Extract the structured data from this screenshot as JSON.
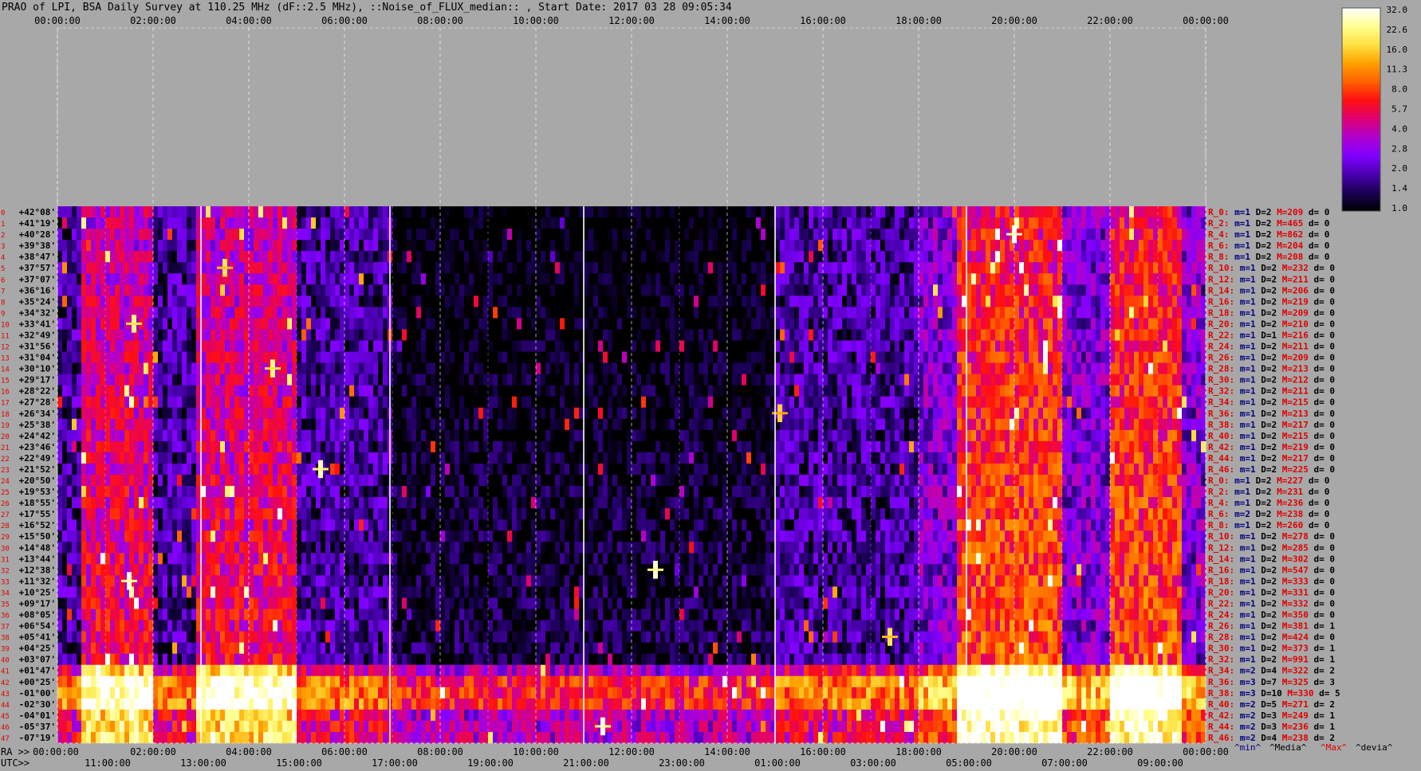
{
  "chart_data": {
    "type": "heatmap",
    "title": "PRAO of LPI, BSA Daily Survey at 110.25 MHz (dF::2.5 MHz), ::Noise_of_FLUX_median:: , Start Date: 2017 03 28 09:05:34",
    "x_axis_top_ticks": [
      "00:00:00",
      "02:00:00",
      "04:00:00",
      "06:00:00",
      "08:00:00",
      "10:00:00",
      "12:00:00",
      "14:00:00",
      "16:00:00",
      "18:00:00",
      "20:00:00",
      "22:00:00",
      "00:00:00"
    ],
    "x_axis_bottom_ra_label": "RA >>",
    "x_axis_bottom_ra_ticks": [
      "00:00:00",
      "02:00:00",
      "04:00:00",
      "06:00:00",
      "08:00:00",
      "10:00:00",
      "12:00:00",
      "14:00:00",
      "16:00:00",
      "18:00:00",
      "20:00:00",
      "22:00:00",
      "00:00:00"
    ],
    "x_axis_bottom_utc_label": "UTC>>",
    "x_axis_bottom_utc_ticks": [
      "11:00:00",
      "13:00:00",
      "15:00:00",
      "17:00:00",
      "19:00:00",
      "21:00:00",
      "23:00:00",
      "01:00:00",
      "03:00:00",
      "05:00:00",
      "07:00:00",
      "09:00:00"
    ],
    "declinations": [
      "+42°08'",
      "+41°19'",
      "+40°28'",
      "+39°38'",
      "+38°47'",
      "+37°57'",
      "+37°07'",
      "+36°16'",
      "+35°24'",
      "+34°32'",
      "+33°41'",
      "+32°49'",
      "+31°56'",
      "+31°04'",
      "+30°10'",
      "+29°17'",
      "+28°22'",
      "+27°28'",
      "+26°34'",
      "+25°38'",
      "+24°42'",
      "+23°46'",
      "+22°49'",
      "+21°52'",
      "+20°50'",
      "+19°53'",
      "+18°55'",
      "+17°55'",
      "+16°52'",
      "+15°50'",
      "+14°48'",
      "+13°44'",
      "+12°38'",
      "+11°32'",
      "+10°25'",
      "+09°17'",
      "+08°05'",
      "+06°54'",
      "+05°41'",
      "+04°25'",
      "+03°07'",
      "+01°47'",
      "+00°25'",
      "-01°00'",
      "-02°30'",
      "-04°01'",
      "-05°37'",
      "-07°19'"
    ],
    "row_index_labels": [
      "0",
      "1",
      "2",
      "3",
      "4",
      "5",
      "6",
      "7",
      "8",
      "9",
      "10",
      "11",
      "12",
      "13",
      "14",
      "15",
      "16",
      "17",
      "18",
      "19",
      "20",
      "21",
      "22",
      "23",
      "24",
      "25",
      "26",
      "27",
      "28",
      "29",
      "30",
      "31",
      "32",
      "33",
      "34",
      "35",
      "36",
      "37",
      "38",
      "39",
      "40",
      "41",
      "42",
      "43",
      "44",
      "45",
      "46",
      "47"
    ],
    "right_stats": [
      {
        "r": "R_0:",
        "m": "m=1",
        "D": "D=2",
        "M": "M=209",
        "d": "d= 0"
      },
      {
        "r": "R_2:",
        "m": "m=1",
        "D": "D=2",
        "M": "M=465",
        "d": "d= 0"
      },
      {
        "r": "R_4:",
        "m": "m=1",
        "D": "D=2",
        "M": "M=862",
        "d": "d= 0"
      },
      {
        "r": "R_6:",
        "m": "m=1",
        "D": "D=2",
        "M": "M=204",
        "d": "d= 0"
      },
      {
        "r": "R_8:",
        "m": "m=1",
        "D": "D=2",
        "M": "M=208",
        "d": "d= 0"
      },
      {
        "r": "R_10:",
        "m": "m=1",
        "D": "D=2",
        "M": "M=232",
        "d": "d= 0"
      },
      {
        "r": "R_12:",
        "m": "m=1",
        "D": "D=2",
        "M": "M=211",
        "d": "d= 0"
      },
      {
        "r": "R_14:",
        "m": "m=1",
        "D": "D=2",
        "M": "M=206",
        "d": "d= 0"
      },
      {
        "r": "R_16:",
        "m": "m=1",
        "D": "D=2",
        "M": "M=219",
        "d": "d= 0"
      },
      {
        "r": "R_18:",
        "m": "m=1",
        "D": "D=2",
        "M": "M=209",
        "d": "d= 0"
      },
      {
        "r": "R_20:",
        "m": "m=1",
        "D": "D=2",
        "M": "M=210",
        "d": "d= 0"
      },
      {
        "r": "R_22:",
        "m": "m=1",
        "D": "D=1",
        "M": "M=216",
        "d": "d= 0"
      },
      {
        "r": "R_24:",
        "m": "m=1",
        "D": "D=2",
        "M": "M=211",
        "d": "d= 0"
      },
      {
        "r": "R_26:",
        "m": "m=1",
        "D": "D=2",
        "M": "M=209",
        "d": "d= 0"
      },
      {
        "r": "R_28:",
        "m": "m=1",
        "D": "D=2",
        "M": "M=213",
        "d": "d= 0"
      },
      {
        "r": "R_30:",
        "m": "m=1",
        "D": "D=2",
        "M": "M=212",
        "d": "d= 0"
      },
      {
        "r": "R_32:",
        "m": "m=1",
        "D": "D=2",
        "M": "M=211",
        "d": "d= 0"
      },
      {
        "r": "R_34:",
        "m": "m=1",
        "D": "D=2",
        "M": "M=215",
        "d": "d= 0"
      },
      {
        "r": "R_36:",
        "m": "m=1",
        "D": "D=2",
        "M": "M=213",
        "d": "d= 0"
      },
      {
        "r": "R_38:",
        "m": "m=1",
        "D": "D=2",
        "M": "M=217",
        "d": "d= 0"
      },
      {
        "r": "R_40:",
        "m": "m=1",
        "D": "D=2",
        "M": "M=215",
        "d": "d= 0"
      },
      {
        "r": "R_42:",
        "m": "m=1",
        "D": "D=2",
        "M": "M=219",
        "d": "d= 0"
      },
      {
        "r": "R_44:",
        "m": "m=1",
        "D": "D=2",
        "M": "M=217",
        "d": "d= 0"
      },
      {
        "r": "R_46:",
        "m": "m=1",
        "D": "D=2",
        "M": "M=225",
        "d": "d= 0"
      },
      {
        "r": "R_0:",
        "m": "m=1",
        "D": "D=2",
        "M": "M=227",
        "d": "d= 0"
      },
      {
        "r": "R_2:",
        "m": "m=1",
        "D": "D=2",
        "M": "M=231",
        "d": "d= 0"
      },
      {
        "r": "R_4:",
        "m": "m=1",
        "D": "D=2",
        "M": "M=236",
        "d": "d= 0"
      },
      {
        "r": "R_6:",
        "m": "m=2",
        "D": "D=2",
        "M": "M=238",
        "d": "d= 0"
      },
      {
        "r": "R_8:",
        "m": "m=1",
        "D": "D=2",
        "M": "M=260",
        "d": "d= 0"
      },
      {
        "r": "R_10:",
        "m": "m=1",
        "D": "D=2",
        "M": "M=278",
        "d": "d= 0"
      },
      {
        "r": "R_12:",
        "m": "m=1",
        "D": "D=2",
        "M": "M=285",
        "d": "d= 0"
      },
      {
        "r": "R_14:",
        "m": "m=1",
        "D": "D=2",
        "M": "M=302",
        "d": "d= 0"
      },
      {
        "r": "R_16:",
        "m": "m=1",
        "D": "D=2",
        "M": "M=547",
        "d": "d= 0"
      },
      {
        "r": "R_18:",
        "m": "m=1",
        "D": "D=2",
        "M": "M=333",
        "d": "d= 0"
      },
      {
        "r": "R_20:",
        "m": "m=1",
        "D": "D=2",
        "M": "M=331",
        "d": "d= 0"
      },
      {
        "r": "R_22:",
        "m": "m=1",
        "D": "D=2",
        "M": "M=332",
        "d": "d= 0"
      },
      {
        "r": "R_24:",
        "m": "m=1",
        "D": "D=2",
        "M": "M=350",
        "d": "d= 0"
      },
      {
        "r": "R_26:",
        "m": "m=1",
        "D": "D=2",
        "M": "M=381",
        "d": "d= 1"
      },
      {
        "r": "R_28:",
        "m": "m=1",
        "D": "D=2",
        "M": "M=424",
        "d": "d= 0"
      },
      {
        "r": "R_30:",
        "m": "m=1",
        "D": "D=2",
        "M": "M=373",
        "d": "d= 1"
      },
      {
        "r": "R_32:",
        "m": "m=1",
        "D": "D=2",
        "M": "M=991",
        "d": "d= 1"
      },
      {
        "r": "R_34:",
        "m": "m=2",
        "D": "D=4",
        "M": "M=322",
        "d": "d= 2"
      },
      {
        "r": "R_36:",
        "m": "m=3",
        "D": "D=7",
        "M": "M=325",
        "d": "d= 3"
      },
      {
        "r": "R_38:",
        "m": "m=3",
        "D": "D=10",
        "M": "M=330",
        "d": "d= 5"
      },
      {
        "r": "R_40:",
        "m": "m=2",
        "D": "D=5",
        "M": "M=271",
        "d": "d= 2"
      },
      {
        "r": "R_42:",
        "m": "m=2",
        "D": "D=3",
        "M": "M=249",
        "d": "d= 1"
      },
      {
        "r": "R_44:",
        "m": "m=2",
        "D": "D=3",
        "M": "M=236",
        "d": "d= 1"
      },
      {
        "r": "R_46:",
        "m": "m=2",
        "D": "D=4",
        "M": "M=238",
        "d": "d= 2"
      }
    ],
    "stats_legend": [
      "^min^",
      "^Media^",
      "^Max^",
      "^devia^"
    ],
    "colorbar": {
      "ticks": [
        "32.0",
        "22.6",
        "16.0",
        "11.3",
        "8.0",
        "5.7",
        "4.0",
        "2.8",
        "2.0",
        "1.4",
        "1.0"
      ],
      "min": 1.0,
      "max": 32.0,
      "scale": "log2",
      "colors": [
        "#000000",
        "#1a0055",
        "#4a00b0",
        "#8000ff",
        "#b000d0",
        "#e00070",
        "#ff1010",
        "#ff6000",
        "#ffa000",
        "#ffe040",
        "#ffff90",
        "#ffffff"
      ]
    },
    "colors": {
      "background": "#a8a8a8",
      "label_red": "#e00000",
      "label_blue": "#000080",
      "grid": "#ffffff"
    },
    "features": {
      "time_range_hours": [
        0,
        24
      ],
      "bright_vertical_bands_hours": [
        [
          0.5,
          2.0
        ],
        [
          2.9,
          5.0
        ],
        [
          18.8,
          21.0
        ],
        [
          22.0,
          23.5
        ]
      ],
      "bright_low_dec_rows": [
        41,
        47
      ],
      "white_vertical_lines_hours": [
        3.0,
        6.95,
        11.0,
        15.0,
        19.0
      ],
      "bright_sources": [
        {
          "t": 20.0,
          "row": 2,
          "v": 32
        },
        {
          "t": 1.5,
          "row": 33,
          "v": 30
        },
        {
          "t": 11.4,
          "row": 46,
          "v": 30
        },
        {
          "t": 12.5,
          "row": 32,
          "v": 28
        },
        {
          "t": 5.5,
          "row": 23,
          "v": 26
        },
        {
          "t": 4.5,
          "row": 14,
          "v": 22
        },
        {
          "t": 1.6,
          "row": 10,
          "v": 22
        },
        {
          "t": 17.4,
          "row": 38,
          "v": 18
        },
        {
          "t": 3.5,
          "row": 5,
          "v": 18
        },
        {
          "t": 15.1,
          "row": 18,
          "v": 16
        }
      ]
    }
  }
}
